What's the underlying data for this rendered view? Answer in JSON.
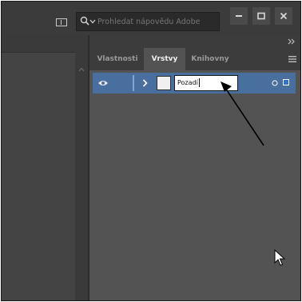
{
  "titlebar": {
    "search_placeholder": "Prohledat nápovědu Adobe",
    "window_controls": [
      "minimize-icon",
      "maximize-icon",
      "close-icon"
    ]
  },
  "panel": {
    "tabs": [
      {
        "label": "Vlastnosti",
        "active": false
      },
      {
        "label": "Vrstvy",
        "active": true
      },
      {
        "label": "Knihovny",
        "active": false
      }
    ],
    "layers": [
      {
        "name": "Pozadí",
        "visible": true,
        "editing": true,
        "selected": true
      }
    ]
  },
  "colors": {
    "selection_row": "#486f9d",
    "selection_square": "#2e73d9",
    "panel_bg": "#535353",
    "chrome_bg": "#3b3b3b"
  }
}
